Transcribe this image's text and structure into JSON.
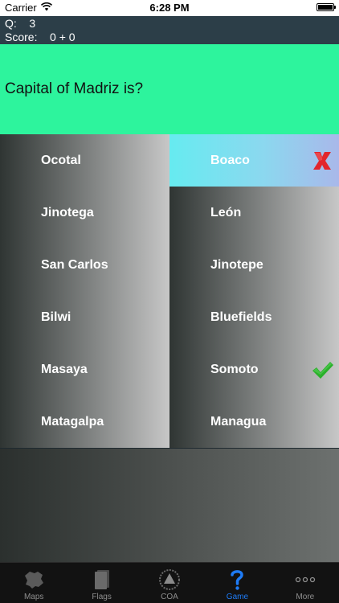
{
  "status_bar": {
    "carrier": "Carrier",
    "time": "6:28 PM"
  },
  "info": {
    "q_label": "Q:",
    "q_value": "3",
    "score_label": "Score:",
    "score_value": "0 + 0"
  },
  "question": {
    "text": "Capital of Madriz is?"
  },
  "answers": {
    "left": [
      "Ocotal",
      "Jinotega",
      "San Carlos",
      "Bilwi",
      "Masaya",
      "Matagalpa"
    ],
    "right": [
      "Boaco",
      "León",
      "Jinotepe",
      "Bluefields",
      "Somoto",
      "Managua"
    ]
  },
  "marks": {
    "wrong_answer": "Boaco",
    "correct_answer": "Somoto",
    "wrong_icon": "x-mark-icon",
    "correct_icon": "check-mark-icon"
  },
  "tabs": [
    {
      "label": "Maps",
      "icon": "map-icon"
    },
    {
      "label": "Flags",
      "icon": "flag-icon"
    },
    {
      "label": "COA",
      "icon": "coat-of-arms-icon"
    },
    {
      "label": "Game",
      "icon": "question-mark-icon",
      "active": true
    },
    {
      "label": "More",
      "icon": "more-dots-icon"
    }
  ],
  "colors": {
    "question_bg": "#2df49d",
    "info_bg": "#2c3e48",
    "selected_cell": "#66ebf0",
    "wrong_mark": "#e2252c",
    "correct_mark": "#2ab02a",
    "active_tab": "#1e7bf5"
  }
}
